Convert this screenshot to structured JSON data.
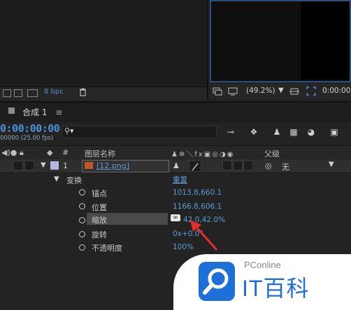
{
  "project": {
    "bpc_label": "8 bpc"
  },
  "viewer": {
    "zoom": "(49.2%)",
    "timecode": "0:00:00"
  },
  "timeline": {
    "tab_label": "合成 1",
    "tab_menu_icon": "≡",
    "timecode": "0:00:00:00",
    "fps": "00000 (25.00 fps)",
    "search_placeholder": ""
  },
  "columns": {
    "hash": "#",
    "layer_name": "图层名称",
    "parent": "父级"
  },
  "layer": {
    "number": "1",
    "name": "[12.png]",
    "parent": "无"
  },
  "transform": {
    "group_label": "变换",
    "reset_label": "重置",
    "properties": [
      {
        "label": "锚点",
        "value": "1013.8,660.1"
      },
      {
        "label": "位置",
        "value": "1166.8,606.1"
      },
      {
        "label": "缩放",
        "value": "42.0,42.0%"
      },
      {
        "label": "旋转",
        "value": "0x+0.0°"
      },
      {
        "label": "不透明度",
        "value": "100%"
      }
    ]
  },
  "watermark": {
    "brand_top": "PConline",
    "brand_main": "IT百科"
  },
  "colors": {
    "accent_blue": "#4a90d9",
    "link_blue": "#5b9bd5",
    "annotation_red": "#e0302a"
  }
}
